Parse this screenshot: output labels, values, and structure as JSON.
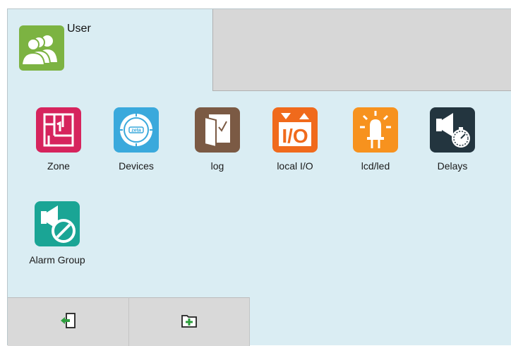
{
  "user": {
    "label": "User",
    "icon": "users-icon",
    "color": "#7cb342"
  },
  "tiles": [
    {
      "label": "Zone",
      "icon": "floorplan-icon",
      "color": "#d6245d"
    },
    {
      "label": "Devices",
      "icon": "zeta-device-icon",
      "color": "#3aa9dc"
    },
    {
      "label": "log",
      "icon": "log-book-icon",
      "color": "#7b5a44"
    },
    {
      "label": "local I/O",
      "icon": "io-icon",
      "color": "#f06a1c"
    },
    {
      "label": "lcd/led",
      "icon": "led-icon",
      "color": "#f7921e"
    },
    {
      "label": "Delays",
      "icon": "delay-timer-icon",
      "color": "#23353f"
    },
    {
      "label": "Alarm Group",
      "icon": "alarm-group-disable-icon",
      "color": "#1aa595"
    }
  ],
  "bottom_buttons": [
    {
      "icon": "logout-icon"
    },
    {
      "icon": "add-folder-icon"
    }
  ]
}
